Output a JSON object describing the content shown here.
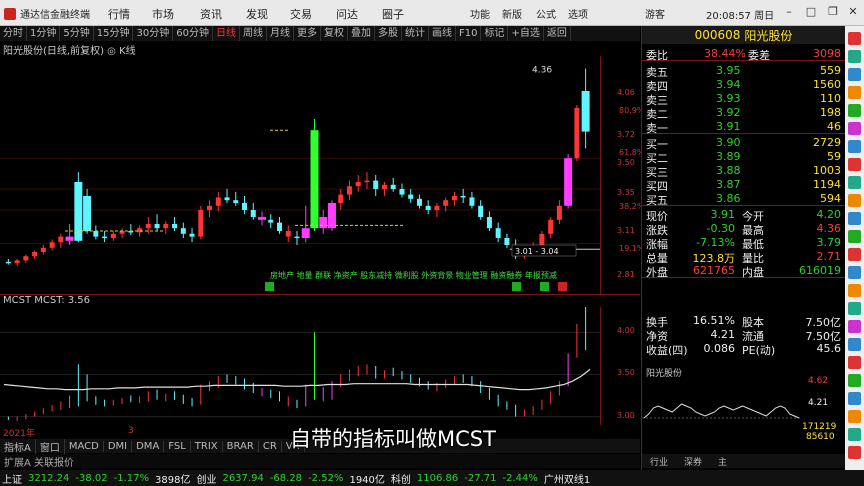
{
  "app": {
    "title": "通达信金融终端",
    "time": "20:08:57 周日",
    "menu": [
      "行情",
      "市场",
      "资讯",
      "发现",
      "交易",
      "问达",
      "圈子"
    ],
    "menu_right": [
      "功能",
      "新版",
      "公式",
      "选项"
    ],
    "account": "游客"
  },
  "toolbar": {
    "items": [
      "分时",
      "1分钟",
      "5分钟",
      "15分钟",
      "30分钟",
      "60分钟",
      "日线",
      "周线",
      "月线",
      "更多",
      "复权",
      "叠加",
      "多股",
      "统计",
      "画线",
      "F10",
      "标记",
      "+自选",
      "返回"
    ],
    "active": "日线"
  },
  "chart": {
    "header": "阳光股份(日线,前复权) ◎ K线",
    "price_labels": [
      "4.06",
      "3.72",
      "3.50",
      "3.35",
      "3.11",
      "2.81"
    ],
    "pct_labels": [
      "80.9%",
      "61.8%",
      "38.2%",
      "19.1%"
    ],
    "high_label": "4.36",
    "range_label": "3.01 - 3.04",
    "concept_text": "房地产 地量 群联 净资产 股东减持 微利股 外资背景 物业管理 融资融券 年报预减"
  },
  "sub": {
    "header": "MCST  MCST: 3.56",
    "labels": [
      "4.00",
      "3.50",
      "3.00"
    ],
    "year_label": "2021年",
    "count": "3"
  },
  "bottom": {
    "tabs": [
      "指标A",
      "窗口",
      "MACD",
      "DMI",
      "DMA",
      "FSL",
      "TRIX",
      "BRAR",
      "CR",
      "VR"
    ],
    "ext": "扩展A  关联报价",
    "right_tabs": [
      "行业",
      "深券",
      "主"
    ]
  },
  "statusbar": {
    "items": [
      {
        "t": "上证",
        "c": "white"
      },
      {
        "t": "3212.24",
        "c": "green"
      },
      {
        "t": "-38.02",
        "c": "green"
      },
      {
        "t": "-1.17%",
        "c": "green"
      },
      {
        "t": "3898亿",
        "c": "white"
      },
      {
        "t": "创业",
        "c": "white"
      },
      {
        "t": "2637.94",
        "c": "green"
      },
      {
        "t": "-68.28",
        "c": "green"
      },
      {
        "t": "-2.52%",
        "c": "green"
      },
      {
        "t": "1940亿",
        "c": "white"
      },
      {
        "t": "科创",
        "c": "white"
      },
      {
        "t": "1106.86",
        "c": "green"
      },
      {
        "t": "-27.71",
        "c": "green"
      },
      {
        "t": "-2.44%",
        "c": "green"
      },
      {
        "t": "广州双线1",
        "c": "white"
      }
    ]
  },
  "subtitle": "自带的指标叫做MCST",
  "stock": {
    "code": "000608",
    "name": "阳光股份",
    "wb_label": "委比",
    "wb_val": "38.44%",
    "wc_label": "委差",
    "wc_val": "3098",
    "asks": [
      {
        "l": "卖五",
        "p": "3.95",
        "v": "559"
      },
      {
        "l": "卖四",
        "p": "3.94",
        "v": "1560"
      },
      {
        "l": "卖三",
        "p": "3.93",
        "v": "110"
      },
      {
        "l": "卖二",
        "p": "3.92",
        "v": "198"
      },
      {
        "l": "卖一",
        "p": "3.91",
        "v": "46"
      }
    ],
    "bids": [
      {
        "l": "买一",
        "p": "3.90",
        "v": "2729"
      },
      {
        "l": "买二",
        "p": "3.89",
        "v": "59"
      },
      {
        "l": "买三",
        "p": "3.88",
        "v": "1003"
      },
      {
        "l": "买四",
        "p": "3.87",
        "v": "1194"
      },
      {
        "l": "买五",
        "p": "3.86",
        "v": "594"
      }
    ],
    "quote": [
      {
        "a": "现价",
        "av": "3.91",
        "ac": "green",
        "b": "今开",
        "bv": "4.20",
        "bc": "green"
      },
      {
        "a": "涨跌",
        "av": "-0.30",
        "ac": "green",
        "b": "最高",
        "bv": "4.36",
        "bc": "red"
      },
      {
        "a": "涨幅",
        "av": "-7.13%",
        "ac": "green",
        "b": "最低",
        "bv": "3.79",
        "bc": "green"
      },
      {
        "a": "总量",
        "av": "123.8万",
        "ac": "yellow",
        "b": "量比",
        "bv": "2.71",
        "bc": "red"
      },
      {
        "a": "外盘",
        "av": "621765",
        "ac": "red",
        "b": "内盘",
        "bv": "616019",
        "bc": "green"
      }
    ],
    "fin": [
      {
        "a": "换手",
        "av": "16.51%",
        "b": "股本",
        "bv": "7.50亿"
      },
      {
        "a": "净资",
        "av": "4.21",
        "b": "流通",
        "bv": "7.50亿"
      },
      {
        "a": "收益(四)",
        "av": "0.086",
        "b": "PE(动)",
        "bv": "45.6"
      }
    ],
    "mini": {
      "title": "阳光股份",
      "hi": "4.62",
      "mid": "4.21",
      "vol": "171219",
      "vol2": "85610"
    }
  }
}
